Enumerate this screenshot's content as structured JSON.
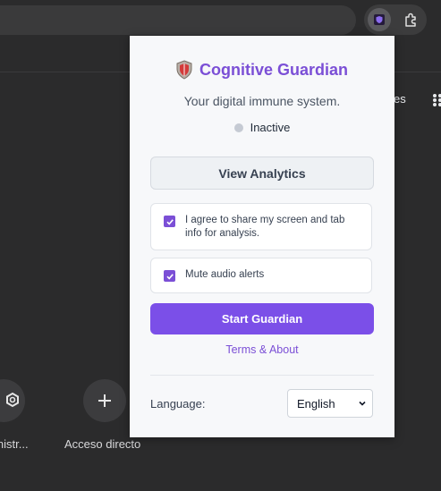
{
  "browser": {
    "shortcuts_label_partial": "es",
    "shortcuts": [
      {
        "label": "inistr...",
        "icon": "gear-hex-icon"
      },
      {
        "label": "Acceso directo",
        "icon": "plus-icon"
      }
    ]
  },
  "popup": {
    "title": "Cognitive Guardian",
    "tagline": "Your digital immune system.",
    "status": {
      "text": "Inactive",
      "dot_color": "#c5cad3"
    },
    "analytics_button": "View Analytics",
    "consent": {
      "label": "I agree to share my screen and tab info for analysis.",
      "checked": true
    },
    "mute": {
      "label": "Mute audio alerts",
      "checked": true
    },
    "start_button": "Start Guardian",
    "terms_link": "Terms & About",
    "language": {
      "label": "Language:",
      "selected": "English"
    },
    "accent_color": "#7b4fd6"
  }
}
